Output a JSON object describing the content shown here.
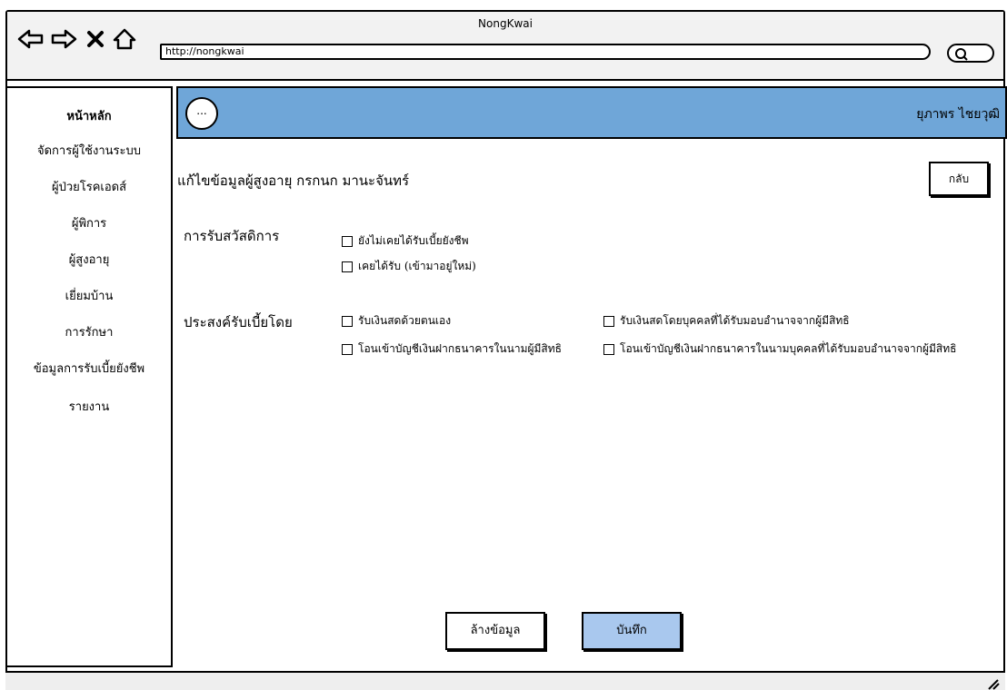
{
  "window": {
    "title": "NongKwai"
  },
  "browser": {
    "url": "http://nongkwai",
    "icons": [
      "back-arrow-icon",
      "forward-arrow-icon",
      "close-icon",
      "home-icon",
      "search-icon"
    ]
  },
  "sidebar": {
    "items": [
      {
        "label": "หน้าหลัก",
        "active": true
      },
      {
        "label": "จัดการผู้ใช้งานระบบ"
      },
      {
        "label": "ผู้ป่วยโรคเอดส์"
      },
      {
        "label": "ผู้พิการ"
      },
      {
        "label": "ผู้สูงอายุ"
      },
      {
        "label": "เยี่ยมบ้าน"
      },
      {
        "label": "การรักษา"
      },
      {
        "label": "ข้อมูลการรับเบี้ยยังชีพ"
      },
      {
        "label": "รายงาน"
      }
    ]
  },
  "header": {
    "more_label": "...",
    "user": "ยุภาพร ไชยวุฒิ",
    "bg_color": "#6fa6d8"
  },
  "main": {
    "title": "แก้ไขข้อมูลผู้สูงอายุ กรกนก มานะจันทร์",
    "back_label": "กลับ",
    "welfare": {
      "label": "การรับสวัสดิการ",
      "options": [
        "ยังไม่เคยได้รับเบี้ยยังชีพ",
        "เคยได้รับ (เข้ามาอยู่ใหม่)"
      ]
    },
    "receive": {
      "label": "ประสงค์รับเบี้ยโดย",
      "options": [
        "รับเงินสดด้วยตนเอง",
        "รับเงินสดโดยบุคคลที่ได้รับมอบอำนาจจากผู้มีสิทธิ",
        "โอนเข้าบัญชีเงินฝากธนาคารในนามผู้มีสิทธิ",
        "โอนเข้าบัญชีเงินฝากธนาคารในนามบุคคลที่ได้รับมอบอำนาจจากผู้มีสิทธิ"
      ]
    },
    "clear_label": "ล้างข้อมูล",
    "save_label": "บันทึก",
    "save_color": "#a9c8ee"
  }
}
